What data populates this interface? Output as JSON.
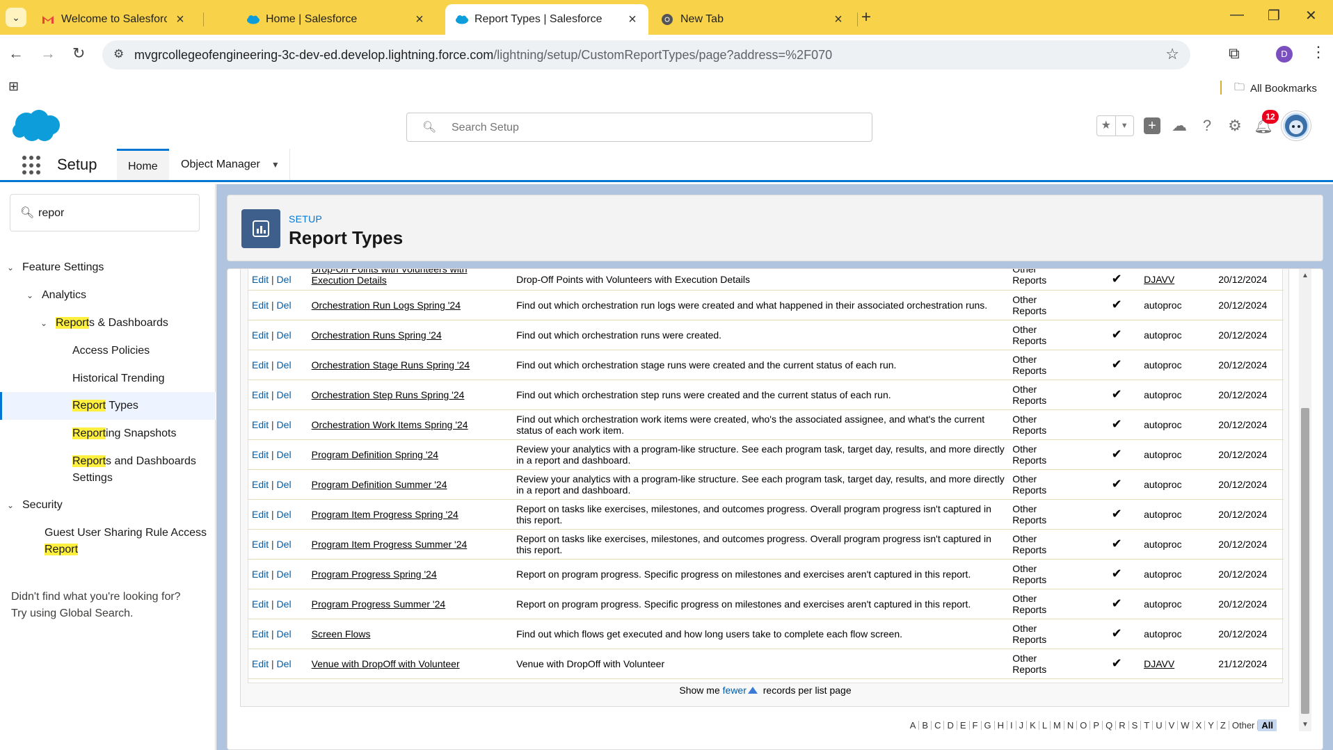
{
  "browser": {
    "tabs": [
      {
        "title": "Welcome to Salesforce: Verify y",
        "icon": "gmail-icon"
      },
      {
        "title": "Home | Salesforce",
        "icon": "salesforce-cloud-icon"
      },
      {
        "title": "Report Types | Salesforce",
        "icon": "salesforce-cloud-icon"
      },
      {
        "title": "New Tab",
        "icon": "chrome-icon"
      }
    ],
    "url_host": "mvgrcollegeofengineering-3c-dev-ed.develop.lightning.force.com",
    "url_path": "/lightning/setup/CustomReportTypes/page?address=%2F070",
    "profile_initial": "D",
    "bookmarks_label": "All Bookmarks",
    "tabbar_color": "#f8d34a"
  },
  "header": {
    "search_placeholder": "Search Setup",
    "notification_count": "12"
  },
  "nav": {
    "app_title": "Setup",
    "tabs": [
      {
        "label": "Home"
      },
      {
        "label": "Object Manager"
      }
    ]
  },
  "sidebar": {
    "quick_find_value": "repor",
    "feature_settings": "Feature Settings",
    "analytics": "Analytics",
    "reports_dashboards": {
      "hl": "Report",
      "rest": "s & Dashboards"
    },
    "access_policies": "Access Policies",
    "historical_trending": "Historical Trending",
    "report_types": {
      "hl": "Report",
      "rest": " Types"
    },
    "reporting_snapshots": {
      "hl": "Report",
      "rest": "ing Snapshots"
    },
    "reports_and_dashboards_settings": {
      "hl": "Report",
      "rest": "s and Dashboards",
      "line2": "Settings"
    },
    "security": "Security",
    "guest_user": {
      "line1": "Guest User Sharing Rule Access",
      "hl": "Report"
    },
    "help_line1": "Didn't find what you're looking for?",
    "help_line2": "Try using Global Search."
  },
  "page_header": {
    "subtitle": "SETUP",
    "title": "Report Types"
  },
  "table": {
    "edit_label": "Edit",
    "del_label": "Del",
    "rows": [
      {
        "label": "Drop-Off Points with Volunteers with Execution Details",
        "description": "Drop-Off Points with Volunteers with Execution Details",
        "category_1": "Other",
        "category_2": "Reports",
        "deployed": "✔",
        "created_by": "DJAVV",
        "created_date": "20/12/2024"
      },
      {
        "label": "Orchestration Run Logs Spring '24",
        "description": "Find out which orchestration run logs were created and what happened in their associated orchestration runs.",
        "category_1": "Other",
        "category_2": "Reports",
        "deployed": "✔",
        "created_by": "autoproc",
        "created_date": "20/12/2024"
      },
      {
        "label": "Orchestration Runs Spring '24",
        "description": "Find out which orchestration runs were created.",
        "category_1": "Other",
        "category_2": "Reports",
        "deployed": "✔",
        "created_by": "autoproc",
        "created_date": "20/12/2024"
      },
      {
        "label": "Orchestration Stage Runs Spring '24",
        "description": "Find out which orchestration stage runs were created and the current status of each run.",
        "category_1": "Other",
        "category_2": "Reports",
        "deployed": "✔",
        "created_by": "autoproc",
        "created_date": "20/12/2024"
      },
      {
        "label": "Orchestration Step Runs Spring '24",
        "description": "Find out which orchestration step runs were created and the current status of each run.",
        "category_1": "Other",
        "category_2": "Reports",
        "deployed": "✔",
        "created_by": "autoproc",
        "created_date": "20/12/2024"
      },
      {
        "label": "Orchestration Work Items Spring '24",
        "description": "Find out which orchestration work items were created, who's the associated assignee, and what's the current status of each work item.",
        "category_1": "Other",
        "category_2": "Reports",
        "deployed": "✔",
        "created_by": "autoproc",
        "created_date": "20/12/2024"
      },
      {
        "label": "Program Definition Spring '24",
        "description": "Review your analytics with a program-like structure. See each program task, target day, results, and more directly in a report and dashboard.",
        "category_1": "Other",
        "category_2": "Reports",
        "deployed": "✔",
        "created_by": "autoproc",
        "created_date": "20/12/2024"
      },
      {
        "label": "Program Definition Summer '24",
        "description": "Review your analytics with a program-like structure. See each program task, target day, results, and more directly in a report and dashboard.",
        "category_1": "Other",
        "category_2": "Reports",
        "deployed": "✔",
        "created_by": "autoproc",
        "created_date": "20/12/2024"
      },
      {
        "label": "Program Item Progress Spring '24",
        "description": "Report on tasks like exercises, milestones, and outcomes progress. Overall program progress isn't captured in this report.",
        "category_1": "Other",
        "category_2": "Reports",
        "deployed": "✔",
        "created_by": "autoproc",
        "created_date": "20/12/2024"
      },
      {
        "label": "Program Item Progress Summer '24",
        "description": "Report on tasks like exercises, milestones, and outcomes progress. Overall program progress isn't captured in this report.",
        "category_1": "Other",
        "category_2": "Reports",
        "deployed": "✔",
        "created_by": "autoproc",
        "created_date": "20/12/2024"
      },
      {
        "label": "Program Progress Spring '24",
        "description": "Report on program progress. Specific progress on milestones and exercises aren't captured in this report.",
        "category_1": "Other",
        "category_2": "Reports",
        "deployed": "✔",
        "created_by": "autoproc",
        "created_date": "20/12/2024"
      },
      {
        "label": "Program Progress Summer '24",
        "description": "Report on program progress. Specific progress on milestones and exercises aren't captured in this report.",
        "category_1": "Other",
        "category_2": "Reports",
        "deployed": "✔",
        "created_by": "autoproc",
        "created_date": "20/12/2024"
      },
      {
        "label": "Screen Flows",
        "description": "Find out which flows get executed and how long users take to complete each flow screen.",
        "category_1": "Other",
        "category_2": "Reports",
        "deployed": "✔",
        "created_by": "autoproc",
        "created_date": "20/12/2024"
      },
      {
        "label": "Venue with DropOff with Volunteer",
        "description": "Venue with DropOff with Volunteer",
        "category_1": "Other",
        "category_2": "Reports",
        "deployed": "✔",
        "created_by": "DJAVV",
        "created_date": "21/12/2024"
      }
    ],
    "show_me_prefix": "Show me",
    "show_me_link": "fewer",
    "show_me_suffix": "records per list page"
  },
  "alphabet": [
    "A",
    "B",
    "C",
    "D",
    "E",
    "F",
    "G",
    "H",
    "I",
    "J",
    "K",
    "L",
    "M",
    "N",
    "O",
    "P",
    "Q",
    "R",
    "S",
    "T",
    "U",
    "V",
    "W",
    "X",
    "Y",
    "Z",
    "Other",
    "All"
  ],
  "alphabet_selected": "All"
}
